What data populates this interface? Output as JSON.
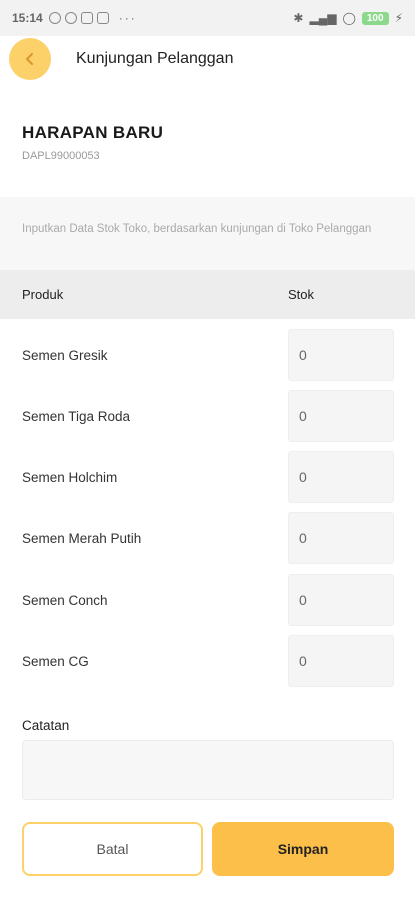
{
  "status_bar": {
    "time": "15:14",
    "dots": "···",
    "battery": "100"
  },
  "app_bar": {
    "title": "Kunjungan Pelanggan",
    "back_icon": "chevron-left-icon"
  },
  "store": {
    "name": "HARAPAN BARU",
    "code": "DAPL99000053"
  },
  "instruction": "Inputkan Data Stok Toko, berdasarkan kunjungan di Toko Pelanggan",
  "table": {
    "headers": {
      "product": "Produk",
      "stock": "Stok"
    },
    "rows": [
      {
        "label": "Semen Gresik",
        "value": "0"
      },
      {
        "label": "Semen Tiga Roda",
        "value": "0"
      },
      {
        "label": "Semen Holchim",
        "value": "0"
      },
      {
        "label": "Semen Merah Putih",
        "value": "0"
      },
      {
        "label": "Semen Conch",
        "value": "0"
      },
      {
        "label": "Semen CG",
        "value": "0"
      }
    ]
  },
  "notes": {
    "label": "Catatan",
    "value": ""
  },
  "buttons": {
    "cancel": "Batal",
    "save": "Simpan"
  },
  "colors": {
    "accent": "#fcbf4a",
    "accent_light": "#fcd16a"
  }
}
